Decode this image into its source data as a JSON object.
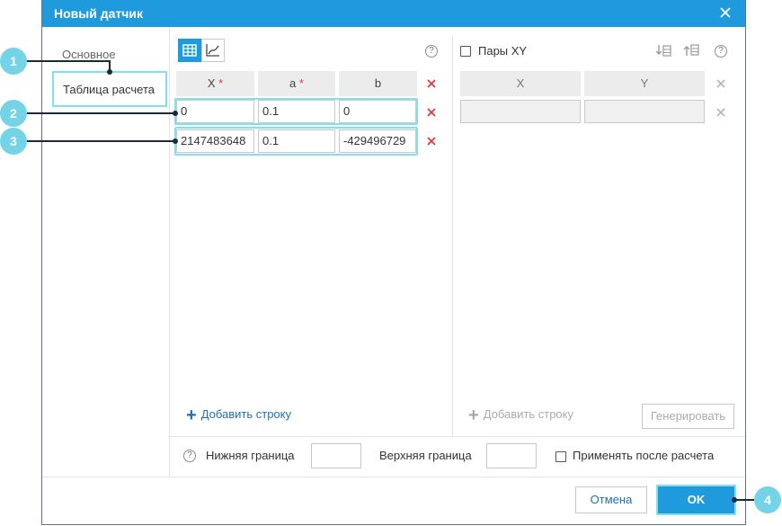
{
  "dialog": {
    "title": "Новый датчик"
  },
  "sidebar": {
    "items": [
      {
        "label": "Основное"
      },
      {
        "label": "Таблица расчета"
      }
    ]
  },
  "table": {
    "headers": [
      {
        "label": "X",
        "required": "*"
      },
      {
        "label": "a",
        "required": "*"
      },
      {
        "label": "b"
      }
    ],
    "rows": [
      {
        "x": "0",
        "a": "0.1",
        "b": "0"
      },
      {
        "x": "2147483648",
        "a": "0.1",
        "b": "-429496729"
      }
    ],
    "add_row_label": "Добавить строку",
    "help": "?"
  },
  "xy": {
    "pairs_label": "Пары XY",
    "pairs_checked": false,
    "headers": [
      "X",
      "Y"
    ],
    "add_row_label": "Добавить строку",
    "generate_label": "Генерировать",
    "help": "?"
  },
  "bounds": {
    "lower_label": "Нижняя граница",
    "upper_label": "Верхняя граница",
    "apply_after_label": "Применять после расчета",
    "help": "?"
  },
  "footer": {
    "cancel_label": "Отмена",
    "ok_label": "OK"
  },
  "callouts": [
    "1",
    "2",
    "3",
    "4"
  ],
  "colors": {
    "accent": "#1f9bdd",
    "highlight": "#7fe0ee",
    "delete": "#e23b3b",
    "callout": "#74d3e6"
  }
}
